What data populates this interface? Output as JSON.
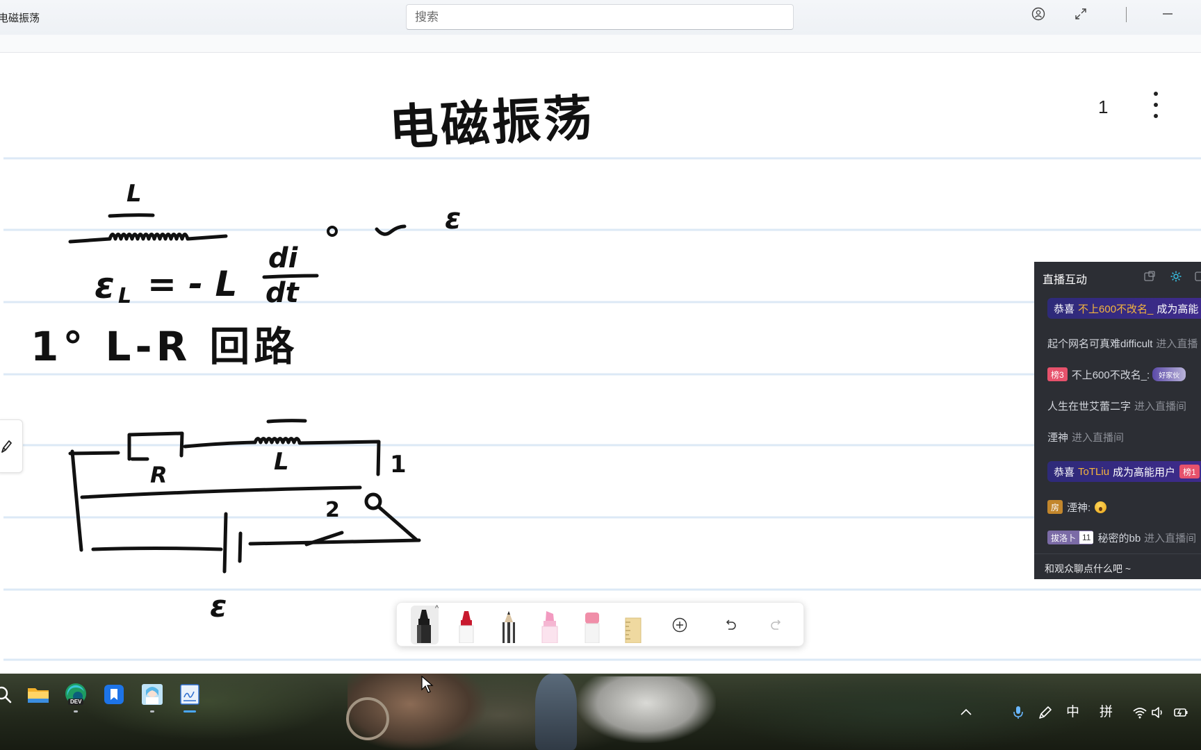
{
  "window": {
    "title": "电磁振荡",
    "search_placeholder": "搜索",
    "icons": {
      "profile": "profile-icon",
      "fullscreen": "fullscreen-icon",
      "minimize": "minimize-icon"
    }
  },
  "canvas": {
    "page_number": "1",
    "heading": "电磁振荡",
    "inductor_label": "L",
    "emf_symbol": "ε",
    "equation": {
      "symbol": "ε",
      "subscript": "L",
      "rhs": "= - L",
      "numerator": "di",
      "denominator": "dt"
    },
    "section_title": "1° L-R 回路",
    "circuit": {
      "resistor": "R",
      "inductor": "L",
      "contact_1": "1",
      "contact_2": "2",
      "source": "ε"
    },
    "icons": {
      "side_tab": "pen-icon",
      "more": "more-vertical-icon"
    }
  },
  "toolbar": {
    "tools": [
      {
        "icon": "black-marker-icon",
        "color": "#1b1b1b",
        "selected": true
      },
      {
        "icon": "red-marker-icon",
        "color": "#c8192e",
        "selected": false
      },
      {
        "icon": "pencil-icon",
        "color": "#2a2a2a",
        "selected": false
      },
      {
        "icon": "highlighter-icon",
        "color": "#f29ac0",
        "selected": false
      },
      {
        "icon": "eraser-icon",
        "color": "#f08ea8",
        "selected": false
      },
      {
        "icon": "ruler-icon",
        "color": "#efd9a0",
        "selected": false
      }
    ],
    "actions": [
      "add-icon",
      "undo-icon",
      "redo-icon"
    ]
  },
  "live_panel": {
    "title": "直播互动",
    "icons": [
      "popout-icon",
      "settings-icon"
    ],
    "messages": [
      {
        "type": "gift",
        "prefix": "恭喜",
        "user": "不上600不改名_",
        "suffix": "成为高能"
      },
      {
        "type": "enter",
        "user": "起个网名可真难difficult",
        "action": "进入直播"
      },
      {
        "type": "chat",
        "badge": "榜3",
        "user": "不上600不改名_:",
        "sticker": "好家伙"
      },
      {
        "type": "enter",
        "user": "人生在世艾蕾二字",
        "action": "进入直播间"
      },
      {
        "type": "enter",
        "user": "湮神",
        "action": "进入直播间"
      },
      {
        "type": "gift",
        "prefix": "恭喜",
        "user": "ToTLiu",
        "suffix": "成为高能用户",
        "badge": "榜1"
      },
      {
        "type": "chat",
        "badge": "房",
        "user": "湮神:",
        "emoji": "surprised-emoji-icon"
      },
      {
        "type": "enter",
        "badge": "拔洛卜",
        "level": "11",
        "user": "秘密的bb",
        "action": "进入直播间"
      }
    ],
    "input_placeholder": "和观众聊点什么吧 ~"
  },
  "taskbar": {
    "apps": [
      {
        "icon": "search-icon"
      },
      {
        "icon": "file-explorer-icon"
      },
      {
        "icon": "edge-dev-icon",
        "badge": "DEV",
        "running": true
      },
      {
        "icon": "blue-app-icon"
      },
      {
        "icon": "photo-app-icon",
        "running": true
      },
      {
        "icon": "whiteboard-icon",
        "running": true,
        "active": true
      }
    ],
    "tray": {
      "ime_mode": "中",
      "ime_layout": "拼",
      "icons": [
        "chevron-up-icon",
        "microphone-icon",
        "pen-icon",
        "wifi-icon",
        "volume-icon",
        "battery-icon"
      ]
    }
  },
  "colors": {
    "accent": "#0067c0",
    "ink": "#111111",
    "ruled_line": "#dce9f6",
    "panel_bg": "#2c2e34",
    "gift_user": "#f5b53d",
    "rank_badge": "#e7526c",
    "room_badge": "#c2862c",
    "fan_badge": "#7b6ba6"
  }
}
